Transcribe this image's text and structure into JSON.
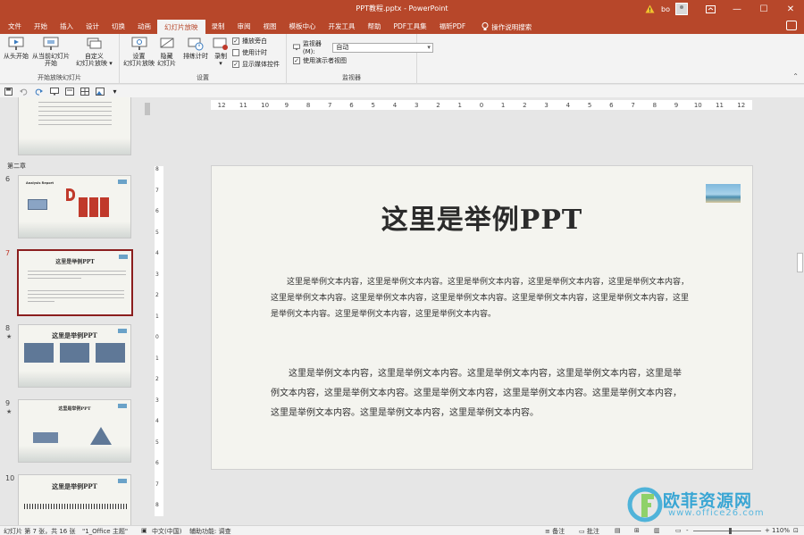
{
  "window": {
    "title": "PPT教程.pptx - PowerPoint",
    "user": "bo",
    "minimize": "—",
    "maximize": "☐",
    "close": "✕"
  },
  "tabs": [
    "文件",
    "开始",
    "插入",
    "设计",
    "切换",
    "动画",
    "幻灯片放映",
    "录制",
    "审阅",
    "视图",
    "模板中心",
    "开发工具",
    "帮助",
    "PDF工具集",
    "福昕PDF"
  ],
  "tab_search": "操作说明搜索",
  "ribbon": {
    "group1": {
      "label": "开始放映幻灯片",
      "from_start": "从头开始",
      "from_current_1": "从当前幻灯片",
      "from_current_2": "开始",
      "custom_1": "自定义",
      "custom_2": "幻灯片放映 ▾"
    },
    "group2": {
      "label": "设置",
      "setup_1": "设置",
      "setup_2": "幻灯片放映",
      "hide_1": "隐藏",
      "hide_2": "幻灯片",
      "rehearse": "排练计时",
      "record_1": "录制",
      "record_2": "▾",
      "play_narrations": "播放旁白",
      "use_timings": "使用计时",
      "show_media_controls": "显示媒体控件"
    },
    "group3": {
      "label": "监视器",
      "monitor_label": "监视器(M):",
      "monitor_value": "自动",
      "presenter_view": "使用演示者视图"
    }
  },
  "panel": {
    "section": "第二章",
    "slides": [
      {
        "num": "6",
        "star": "",
        "title": "Analysis Report"
      },
      {
        "num": "7",
        "star": "",
        "title": "这里是举例PPT"
      },
      {
        "num": "8",
        "star": "★",
        "title": "这里是举例PPT"
      },
      {
        "num": "9",
        "star": "★",
        "title": "这里是举例PPT"
      },
      {
        "num": "10",
        "star": "",
        "title": "这里是举例PPT"
      }
    ]
  },
  "ruler": [
    "12",
    "11",
    "10",
    "9",
    "8",
    "7",
    "6",
    "5",
    "4",
    "3",
    "2",
    "1",
    "0",
    "1",
    "2",
    "3",
    "4",
    "5",
    "6",
    "7",
    "8",
    "9",
    "10",
    "11",
    "12"
  ],
  "vruler": [
    "8",
    "7",
    "6",
    "5",
    "4",
    "3",
    "2",
    "1",
    "0",
    "1",
    "2",
    "3",
    "4",
    "5",
    "6",
    "7",
    "8"
  ],
  "slide": {
    "title": "这里是举例PPT",
    "para1": "这里是举例文本内容，这里是举例文本内容。这里是举例文本内容，这里是举例文本内容，这里是举例文本内容，这里是举例文本内容。这里是举例文本内容，这里是举例文本内容。这里是举例文本内容，这里是举例文本内容，这里是举例文本内容。这里是举例文本内容，这里是举例文本内容。",
    "para2": "这里是举例文本内容，这里是举例文本内容。这里是举例文本内容，这里是举例文本内容，这里是举例文本内容，这里是举例文本内容。这里是举例文本内容，这里是举例文本内容。这里是举例文本内容，这里是举例文本内容。这里是举例文本内容，这里是举例文本内容。"
  },
  "watermark": {
    "text": "欧菲资源网",
    "url": "www.office26.com"
  },
  "status": {
    "slide_info": "幻灯片 第 7 张，共 16 张",
    "theme": "\"1_Office 主题\"",
    "language": "中文(中国)",
    "accessibility": "辅助功能: 调查",
    "notes": "备注",
    "comments": "批注",
    "zoom": "110%",
    "zoom_minus": "-",
    "zoom_plus": "+"
  },
  "colors": {
    "brand": "#b7472a",
    "selected_border": "#8b1e1e",
    "watermark": "#3aa6d4"
  }
}
